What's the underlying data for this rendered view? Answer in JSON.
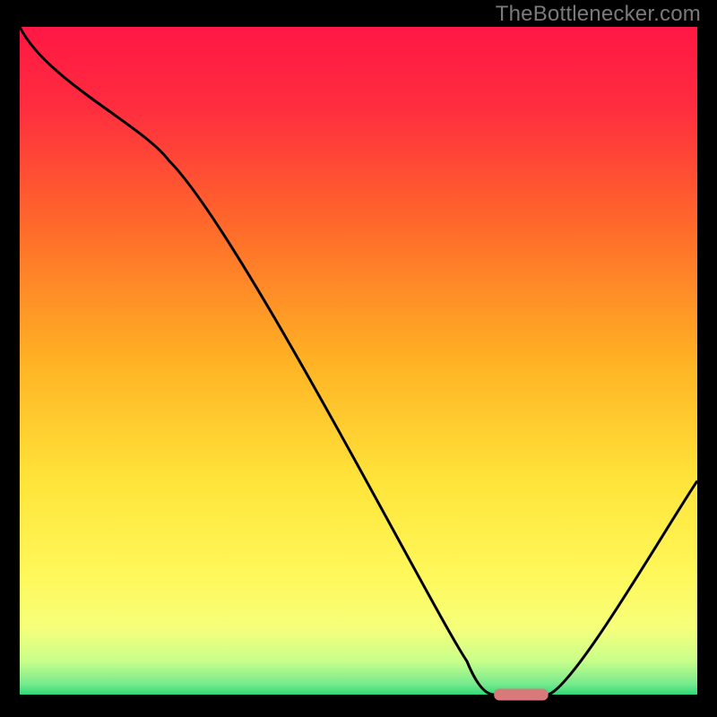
{
  "watermark": "TheBottlenecker.com",
  "chart_data": {
    "type": "line",
    "title": "",
    "xlabel": "",
    "ylabel": "",
    "xlim": [
      0,
      100
    ],
    "ylim": [
      0,
      100
    ],
    "grid": false,
    "legend": false,
    "x": [
      0,
      22,
      66,
      70,
      78,
      100
    ],
    "values": [
      100,
      80,
      5,
      0,
      0,
      32
    ],
    "optimum_band": {
      "x_start": 70,
      "x_end": 78,
      "y": 0
    },
    "background_gradient": {
      "stops": [
        {
          "offset": 0.0,
          "color": "#ff1744"
        },
        {
          "offset": 0.12,
          "color": "#ff2d3f"
        },
        {
          "offset": 0.3,
          "color": "#ff6a2a"
        },
        {
          "offset": 0.5,
          "color": "#ffb224"
        },
        {
          "offset": 0.68,
          "color": "#ffe43a"
        },
        {
          "offset": 0.82,
          "color": "#fff85a"
        },
        {
          "offset": 0.9,
          "color": "#f6ff7a"
        },
        {
          "offset": 0.95,
          "color": "#c8ff8a"
        },
        {
          "offset": 0.985,
          "color": "#74e98e"
        },
        {
          "offset": 1.0,
          "color": "#2fd876"
        }
      ]
    },
    "marker_color": "#d87a7a"
  }
}
